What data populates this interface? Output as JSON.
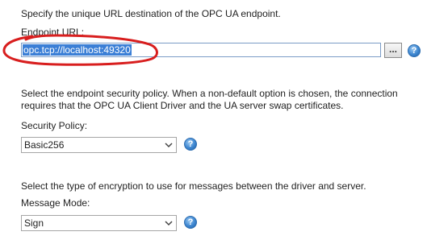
{
  "endpoint": {
    "description": "Specify the unique URL destination of the OPC UA endpoint.",
    "label": "Endpoint URL:",
    "value": "opc.tcp://localhost:49320",
    "browse_label": "..."
  },
  "security": {
    "description_line1": "Select the endpoint security policy. When a non-default option is chosen, the connection",
    "description_line2": "requires that the OPC UA Client Driver and the UA server swap certificates.",
    "label": "Security Policy:",
    "value": "Basic256"
  },
  "message": {
    "description": "Select the type of encryption to use for messages between the driver and server.",
    "label": "Message Mode:",
    "value": "Sign"
  },
  "help_glyph": "?",
  "colors": {
    "annotation": "#d81e1e",
    "selection": "#3b7fd6",
    "help_icon": "#3d86d0"
  },
  "icons": [
    "help-icon",
    "chevron-down-icon"
  ]
}
